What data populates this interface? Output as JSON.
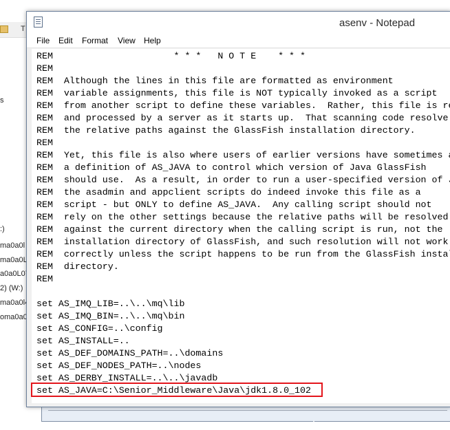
{
  "background_window": {
    "folder_label": "T",
    "items": [
      "s",
      ":)",
      "ma0a0l",
      "ma0a0L0",
      "a0a0L07",
      "2) (W:)",
      "ma0a0l4",
      "oma0a0"
    ]
  },
  "notepad": {
    "title": "asenv - Notepad",
    "menu": [
      "File",
      "Edit",
      "Format",
      "View",
      "Help"
    ],
    "lines": [
      "REM                      * * *   N O T E    * * *",
      "REM",
      "REM  Although the lines in this file are formatted as environment",
      "REM  variable assignments, this file is NOT typically invoked as a script",
      "REM  from another script to define these variables.  Rather, this file is re",
      "REM  and processed by a server as it starts up.  That scanning code resolve",
      "REM  the relative paths against the GlassFish installation directory.",
      "REM",
      "REM  Yet, this file is also where users of earlier versions have sometimes a",
      "REM  a definition of AS_JAVA to control which version of Java GlassFish",
      "REM  should use.  As a result, in order to run a user-specified version of J",
      "REM  the asadmin and appclient scripts do indeed invoke this file as a",
      "REM  script - but ONLY to define AS_JAVA.  Any calling script should not",
      "REM  rely on the other settings because the relative paths will be resolved",
      "REM  against the current directory when the calling script is run, not the",
      "REM  installation directory of GlassFish, and such resolution will not work",
      "REM  correctly unless the script happens to be run from the GlassFish instal",
      "REM  directory.",
      "REM",
      "",
      "set AS_IMQ_LIB=..\\..\\mq\\lib",
      "set AS_IMQ_BIN=..\\..\\mq\\bin",
      "set AS_CONFIG=..\\config",
      "set AS_INSTALL=..",
      "set AS_DEF_DOMAINS_PATH=..\\domains",
      "set AS_DEF_NODES_PATH=..\\nodes",
      "set AS_DERBY_INSTALL=..\\..\\javadb",
      "set AS_JAVA=C:\\Senior_Middleware\\Java\\jdk1.8.0_102"
    ]
  },
  "colors": {
    "highlight": "#e3141b",
    "window_border": "#6b7f9a"
  },
  "icons": [
    "notepad-icon",
    "folder-icon",
    "mouse-cursor-icon"
  ]
}
